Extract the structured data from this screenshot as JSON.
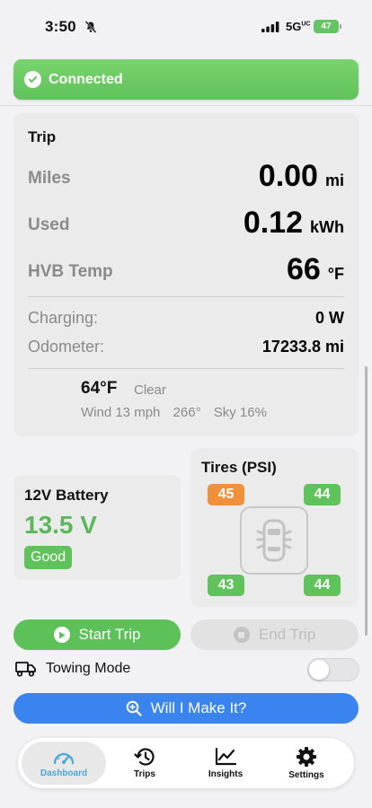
{
  "status_bar": {
    "time": "3:50",
    "network": "5G",
    "network_sup": "UC",
    "battery": "47"
  },
  "banner": {
    "label": "Connected",
    "color": "#5fc25a"
  },
  "trip": {
    "title": "Trip",
    "metrics": [
      {
        "label": "Miles",
        "value": "0.00",
        "unit": "mi"
      },
      {
        "label": "Used",
        "value": "0.12",
        "unit": "kWh"
      },
      {
        "label": "HVB Temp",
        "value": "66",
        "unit": "°F"
      }
    ],
    "info": [
      {
        "label": "Charging:",
        "value": "0 W"
      },
      {
        "label": "Odometer:",
        "value": "17233.8 mi"
      }
    ],
    "weather": {
      "temp": "64°F",
      "condition": "Clear",
      "wind": "Wind 13 mph",
      "direction": "266°",
      "sky": "Sky 16%"
    }
  },
  "battery": {
    "title": "12V Battery",
    "value": "13.5 V",
    "status": "Good",
    "color": "#5bb85a"
  },
  "tires": {
    "title": "Tires (PSI)",
    "front_left": "45",
    "front_right": "44",
    "rear_left": "43",
    "rear_right": "44",
    "warn_color": "#f0903a",
    "ok_color": "#5fc25a"
  },
  "actions": {
    "start_trip": "Start Trip",
    "end_trip": "End Trip",
    "towing_label": "Towing Mode",
    "towing_on": false,
    "will_i_make_it": "Will I Make It?"
  },
  "tab_bar": {
    "tabs": [
      {
        "label": "Dashboard",
        "icon": "gauge-icon",
        "active": true
      },
      {
        "label": "Trips",
        "icon": "history-icon",
        "active": false
      },
      {
        "label": "Insights",
        "icon": "chart-line-icon",
        "active": false
      },
      {
        "label": "Settings",
        "icon": "gear-icon",
        "active": false
      }
    ]
  }
}
